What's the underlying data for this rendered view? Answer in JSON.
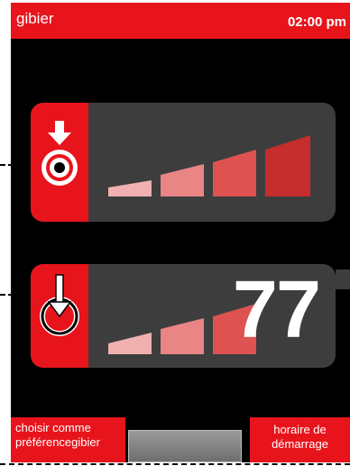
{
  "header": {
    "title": "gibier",
    "time": "02:00 pm"
  },
  "panel_top": {
    "icon": "target-arrow-icon",
    "level_bars": 4
  },
  "panel_bottom": {
    "icon": "power-arrow-icon",
    "level_bars": 3,
    "value": "77"
  },
  "softkeys": {
    "left_line1": "choisir comme",
    "left_line2": "préférencegibier",
    "right_line1": "horaire de",
    "right_line2": "démarrage"
  },
  "colors": {
    "accent": "#e8141c",
    "panel": "#3d3d3d",
    "background": "#000000"
  }
}
